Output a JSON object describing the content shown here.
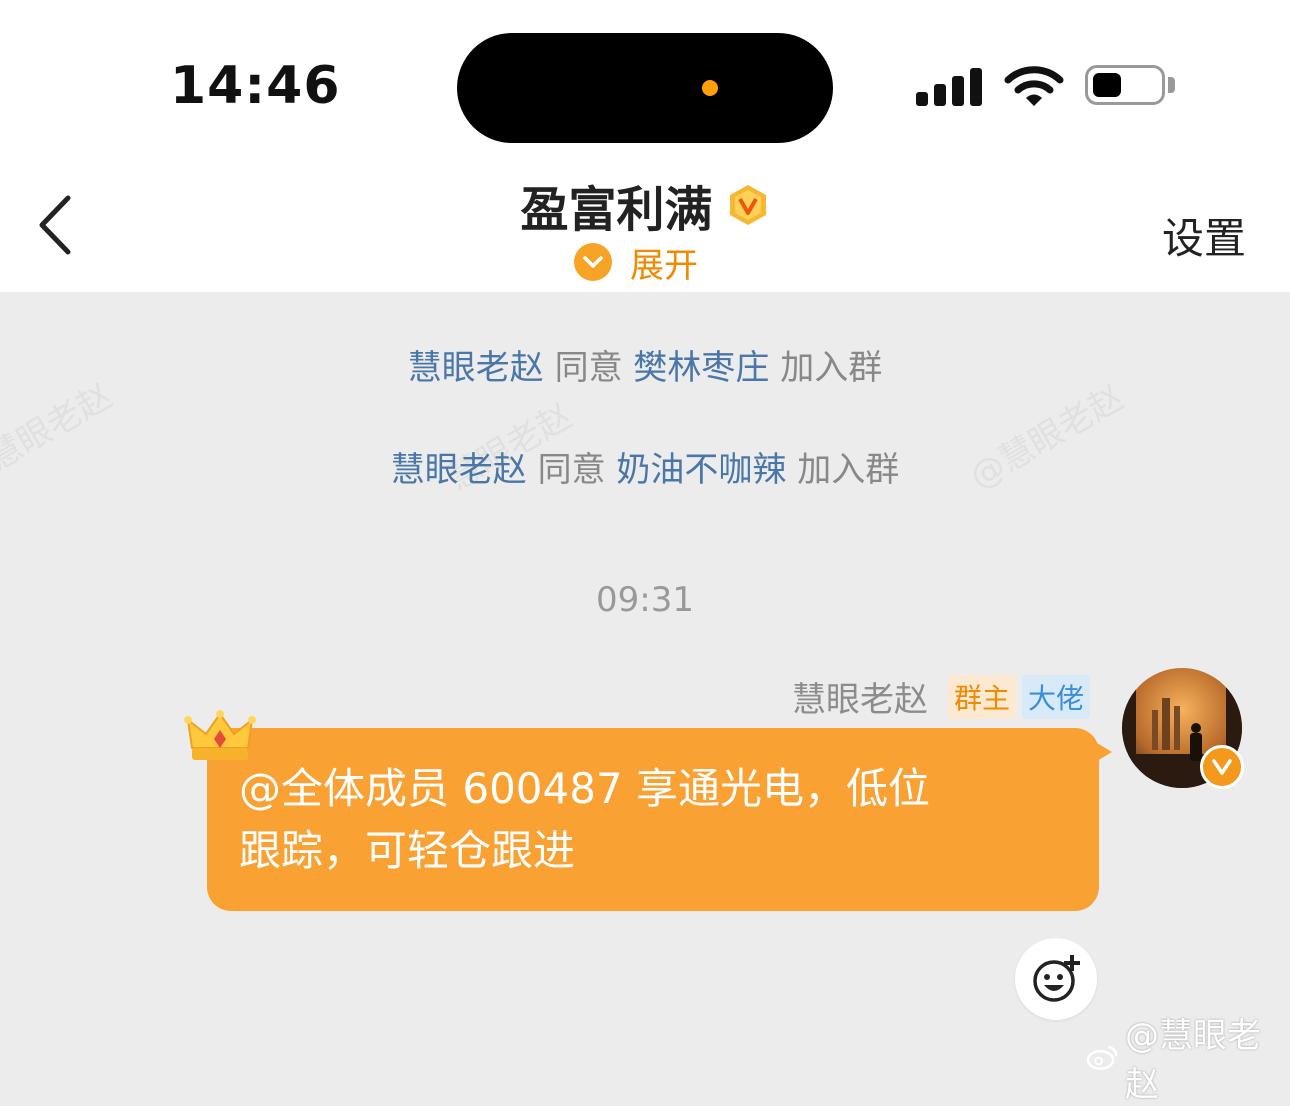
{
  "status_bar": {
    "time": "14:46"
  },
  "header": {
    "title": "盈富利满",
    "expand_label": "展开",
    "settings_label": "设置"
  },
  "system_messages": [
    {
      "user": "慧眼老赵",
      "action": "同意",
      "target": "樊林枣庄",
      "suffix": "加入群"
    },
    {
      "user": "慧眼老赵",
      "action": "同意",
      "target": "奶油不咖辣",
      "suffix": "加入群"
    }
  ],
  "timestamp": "09:31",
  "message": {
    "sender": "慧眼老赵",
    "tags": [
      "群主",
      "大佬"
    ],
    "text_line1": "@全体成员 600487 享通光电，低位",
    "text_line2": "跟踪，可轻仓跟进"
  },
  "watermarks": [
    "慧眼老赵",
    "慧眼老赵",
    "@慧眼老赵"
  ],
  "weibo_watermark": "@慧眼老赵",
  "icons": [
    "back-chevron-icon",
    "v-badge-icon",
    "chevron-down-icon",
    "crown-icon",
    "emoji-add-icon",
    "weibo-logo-icon"
  ],
  "colors": {
    "accent": "#f9a132",
    "link": "#4a76a8",
    "background": "#ececec"
  }
}
